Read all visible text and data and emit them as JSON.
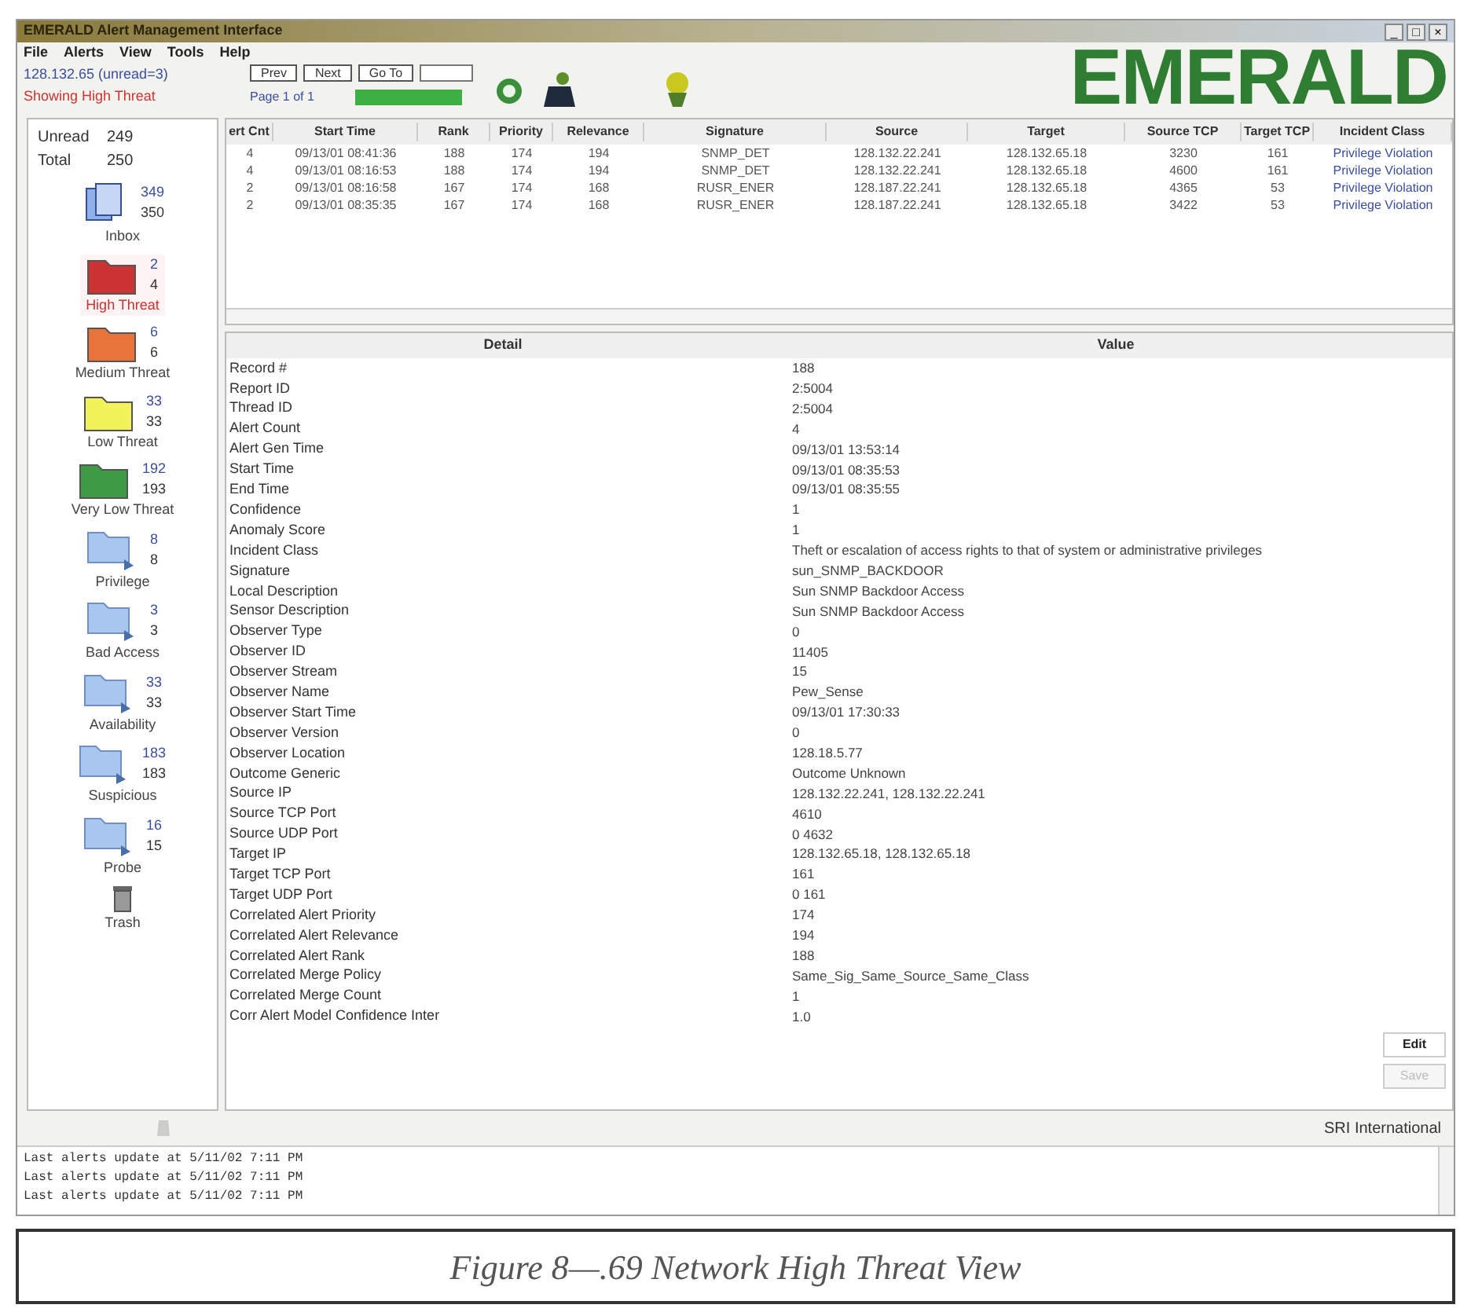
{
  "window": {
    "title": "EMERALD Alert Management Interface",
    "controls": [
      "_",
      "□",
      "×"
    ]
  },
  "menu": [
    "File",
    "Alerts",
    "View",
    "Tools",
    "Help"
  ],
  "connection": {
    "host": "128.132.65 (unread=3)",
    "filter": "Showing High Threat"
  },
  "pager": {
    "buttons": [
      "Prev",
      "Next",
      "Go To"
    ],
    "page_label": "Page 1 of 1"
  },
  "logo": "EMERALD",
  "summary": [
    {
      "label": "Unread",
      "value": "249"
    },
    {
      "label": "Total",
      "value": "250"
    }
  ],
  "folders": [
    {
      "kind": "inbox",
      "label": "Inbox",
      "unread": "349",
      "total": "350",
      "selected": false
    },
    {
      "kind": "folder",
      "color": "#cc3333",
      "label": "High Threat",
      "unread": "2",
      "total": "4",
      "selected": true
    },
    {
      "kind": "folder",
      "color": "#e8743b",
      "label": "Medium Threat",
      "unread": "6",
      "total": "6",
      "selected": false
    },
    {
      "kind": "folder",
      "color": "#f2f25a",
      "label": "Low Threat",
      "unread": "33",
      "total": "33",
      "selected": false
    },
    {
      "kind": "folder",
      "color": "#3f9a45",
      "label": "Very Low Threat",
      "unread": "192",
      "total": "193",
      "selected": false
    },
    {
      "kind": "category",
      "label": "Privilege",
      "unread": "8",
      "total": "8",
      "selected": false
    },
    {
      "kind": "category",
      "label": "Bad Access",
      "unread": "3",
      "total": "3",
      "selected": false
    },
    {
      "kind": "category",
      "label": "Availability",
      "unread": "33",
      "total": "33",
      "selected": false
    },
    {
      "kind": "category",
      "label": "Suspicious",
      "unread": "183",
      "total": "183",
      "selected": false
    },
    {
      "kind": "category",
      "label": "Probe",
      "unread": "16",
      "total": "15",
      "selected": false
    },
    {
      "kind": "trash",
      "label": "Trash",
      "selected": false
    }
  ],
  "alerts": {
    "columns": [
      "ert Cnt",
      "Start Time",
      "Rank",
      "Priority",
      "Relevance",
      "Signature",
      "Source",
      "Target",
      "Source TCP",
      "Target TCP",
      "Incident Class"
    ],
    "rows": [
      [
        "4",
        "09/13/01 08:41:36",
        "188",
        "174",
        "194",
        "SNMP_DET",
        "128.132.22.241",
        "128.132.65.18",
        "3230",
        "161",
        "Privilege Violation"
      ],
      [
        "4",
        "09/13/01 08:16:53",
        "188",
        "174",
        "194",
        "SNMP_DET",
        "128.132.22.241",
        "128.132.65.18",
        "4600",
        "161",
        "Privilege Violation"
      ],
      [
        "2",
        "09/13/01 08:16:58",
        "167",
        "174",
        "168",
        "RUSR_ENER",
        "128.187.22.241",
        "128.132.65.18",
        "4365",
        "53",
        "Privilege Violation"
      ],
      [
        "2",
        "09/13/01 08:35:35",
        "167",
        "174",
        "168",
        "RUSR_ENER",
        "128.187.22.241",
        "128.132.65.18",
        "3422",
        "53",
        "Privilege Violation"
      ]
    ]
  },
  "detail": {
    "columns": [
      "Detail",
      "Value"
    ],
    "rows": [
      {
        "field": "Record #",
        "value": "188"
      },
      {
        "field": "Report ID",
        "value": "2:5004"
      },
      {
        "field": "Thread ID",
        "value": "2:5004"
      },
      {
        "field": "Alert Count",
        "value": "4"
      },
      {
        "field": "Alert Gen Time",
        "value": "09/13/01 13:53:14"
      },
      {
        "field": "Start Time",
        "value": "09/13/01 08:35:53"
      },
      {
        "field": "End Time",
        "value": "09/13/01 08:35:55"
      },
      {
        "field": "Confidence",
        "value": "1"
      },
      {
        "field": "Anomaly Score",
        "value": "1"
      },
      {
        "field": "Incident Class",
        "value": "Theft or escalation of access rights to that of system or administrative privileges"
      },
      {
        "field": "Signature",
        "value": "sun_SNMP_BACKDOOR"
      },
      {
        "field": "Local Description",
        "value": "Sun SNMP Backdoor Access"
      },
      {
        "field": "Sensor Description",
        "value": "Sun SNMP Backdoor Access"
      },
      {
        "field": "Observer Type",
        "value": "0"
      },
      {
        "field": "Observer ID",
        "value": "11405"
      },
      {
        "field": "Observer Stream",
        "value": "15"
      },
      {
        "field": "Observer Name",
        "value": "Pew_Sense"
      },
      {
        "field": "Observer Start Time",
        "value": "09/13/01 17:30:33"
      },
      {
        "field": "Observer Version",
        "value": "0"
      },
      {
        "field": "Observer Location",
        "value": "128.18.5.77"
      },
      {
        "field": "Outcome Generic",
        "value": "Outcome Unknown"
      },
      {
        "field": "Source IP",
        "value": "128.132.22.241, 128.132.22.241"
      },
      {
        "field": "Source TCP Port",
        "value": "4610"
      },
      {
        "field": "Source UDP Port",
        "value": "0 4632"
      },
      {
        "field": "Target IP",
        "value": "128.132.65.18, 128.132.65.18"
      },
      {
        "field": "Target TCP Port",
        "value": "161"
      },
      {
        "field": "Target UDP Port",
        "value": "0 161"
      },
      {
        "field": "Correlated Alert Priority",
        "value": "174"
      },
      {
        "field": "Correlated Alert Relevance",
        "value": "194"
      },
      {
        "field": "Correlated Alert Rank",
        "value": "188"
      },
      {
        "field": "Correlated Merge Policy",
        "value": "Same_Sig_Same_Source_Same_Class"
      },
      {
        "field": "Correlated Merge Count",
        "value": "1"
      },
      {
        "field": "Corr Alert Model Confidence Inter",
        "value": "1.0"
      }
    ]
  },
  "actions": [
    {
      "label": "Edit",
      "disabled": false
    },
    {
      "label": "Save",
      "disabled": true
    }
  ],
  "status": "SRI International",
  "log": [
    "Last alerts update at 5/11/02 7:11 PM",
    "Last alerts update at 5/11/02 7:11 PM",
    "Last alerts update at 5/11/02 7:11 PM"
  ],
  "caption": "Figure 8—.69 Network High Threat View"
}
